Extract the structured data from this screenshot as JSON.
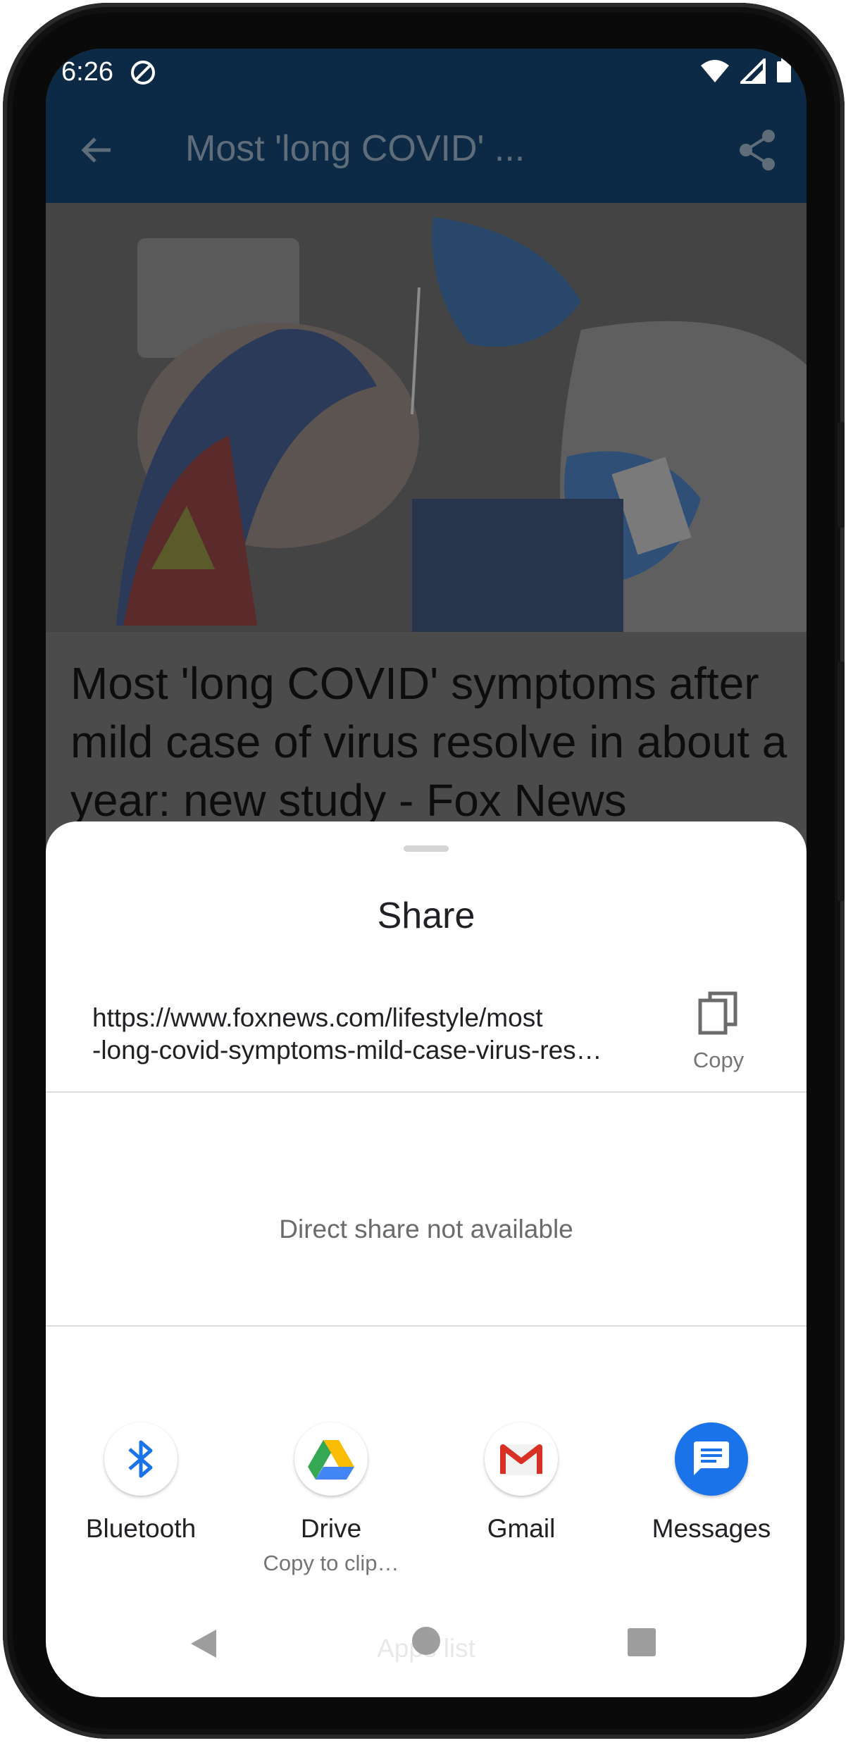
{
  "status_bar": {
    "time": "6:26"
  },
  "app_bar": {
    "title": "Most 'long COVID' ..."
  },
  "article": {
    "title": "Most 'long COVID' symptoms after mild case of virus resolve in about a year: new study - Fox News"
  },
  "share_sheet": {
    "title": "Share",
    "url_line1": "https://www.foxnews.com/lifestyle/most",
    "url_line2": "-long-covid-symptoms-mild-case-virus-res…",
    "copy_label": "Copy",
    "direct_share_message": "Direct share not available",
    "targets": [
      {
        "label": "Bluetooth",
        "sublabel": "",
        "icon": "bluetooth-icon"
      },
      {
        "label": "Drive",
        "sublabel": "Copy to clip…",
        "icon": "google-drive-icon"
      },
      {
        "label": "Gmail",
        "sublabel": "",
        "icon": "gmail-icon"
      },
      {
        "label": "Messages",
        "sublabel": "",
        "icon": "messages-icon"
      }
    ],
    "nav_hint": "Apps list"
  },
  "colors": {
    "app_bar": "#0c2a45",
    "messages_blue": "#1a73e8",
    "bluetooth_blue": "#1a73e8",
    "gmail_red": "#d93025"
  }
}
